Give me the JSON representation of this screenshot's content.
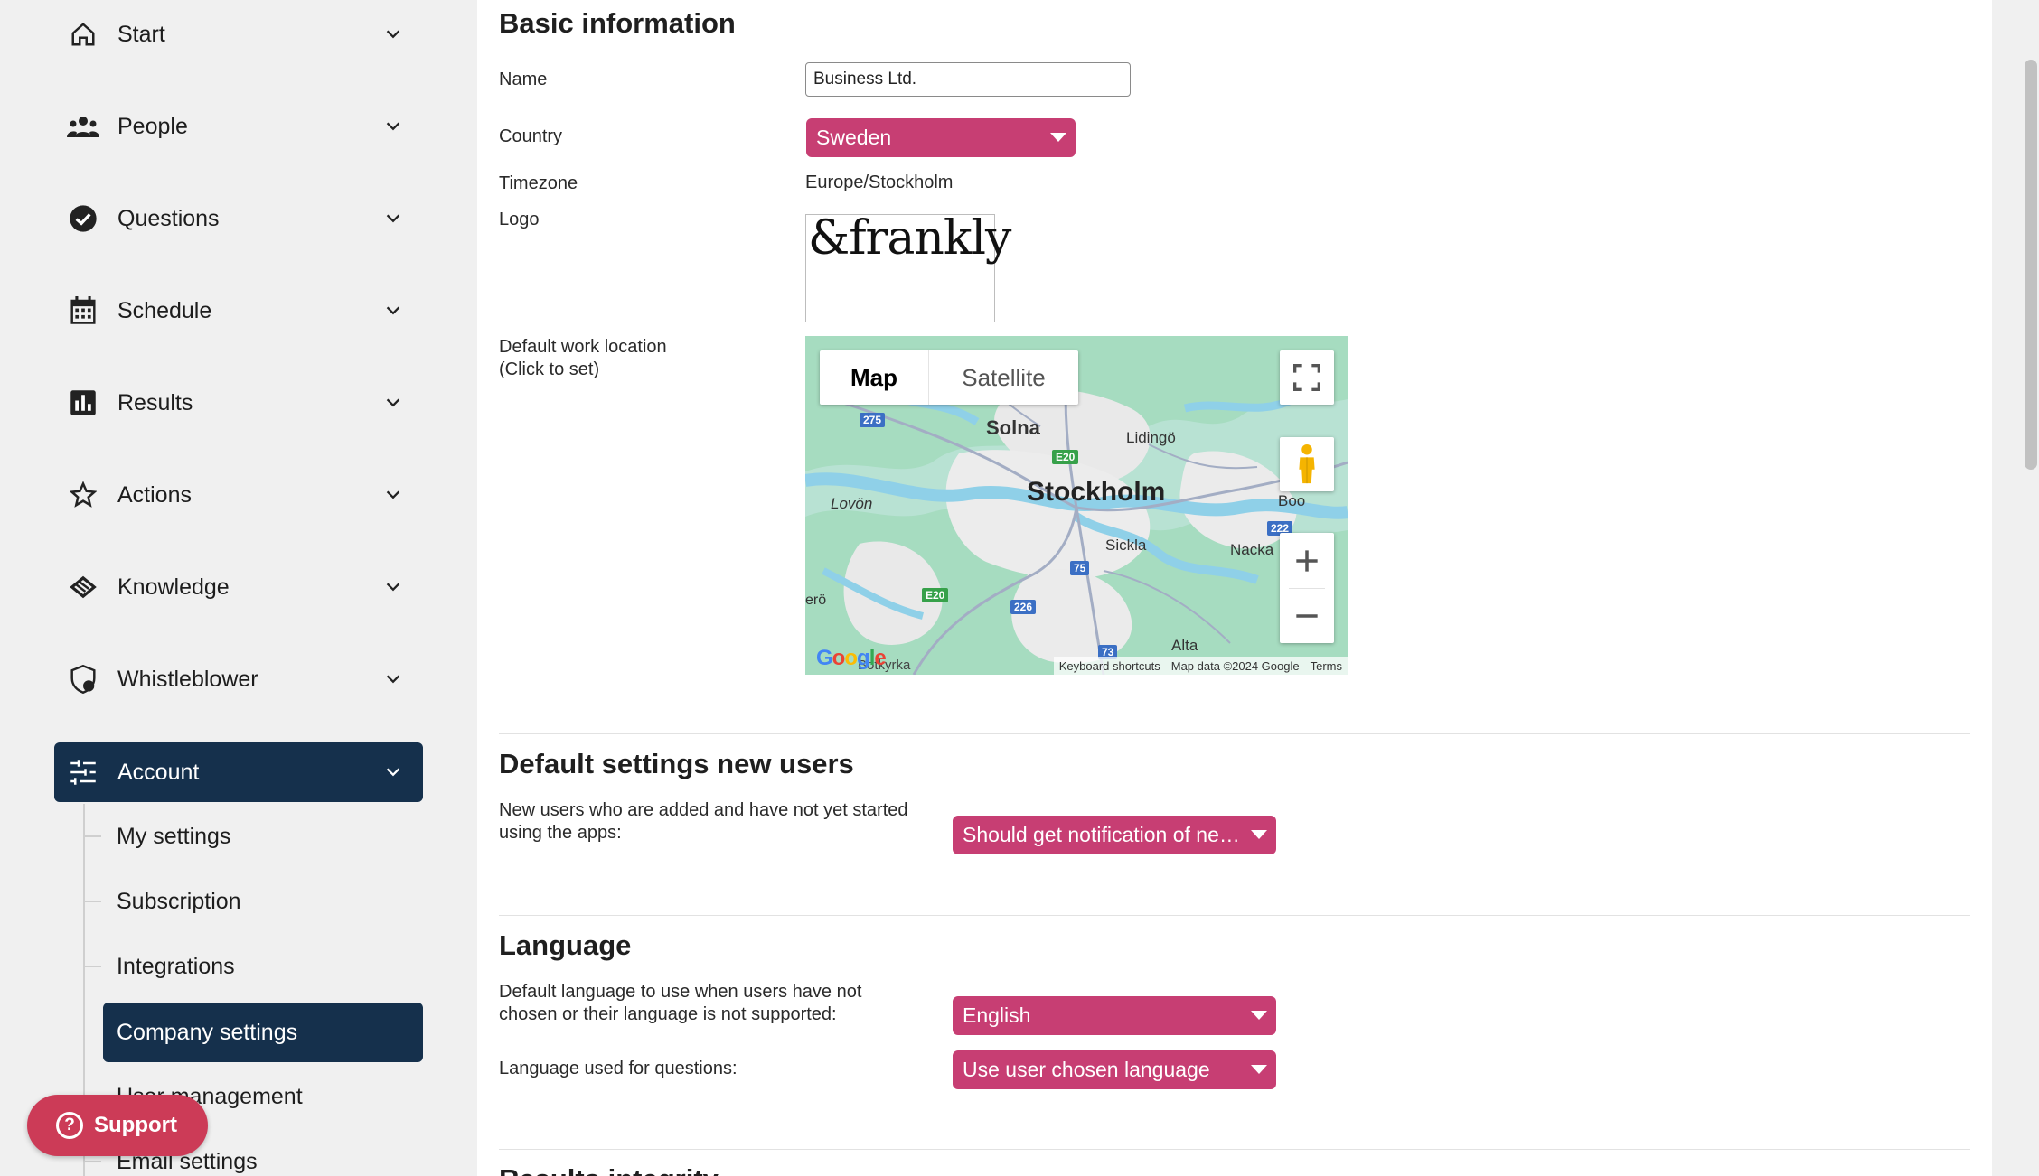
{
  "sidebar": {
    "items": [
      {
        "label": "Start",
        "icon": "home-icon"
      },
      {
        "label": "People",
        "icon": "people-icon"
      },
      {
        "label": "Questions",
        "icon": "check-circle-icon"
      },
      {
        "label": "Schedule",
        "icon": "calendar-icon"
      },
      {
        "label": "Results",
        "icon": "bar-chart-icon"
      },
      {
        "label": "Actions",
        "icon": "star-icon"
      },
      {
        "label": "Knowledge",
        "icon": "knowledge-icon"
      },
      {
        "label": "Whistleblower",
        "icon": "shield-icon"
      },
      {
        "label": "Account",
        "icon": "sliders-icon"
      }
    ],
    "sub_items": [
      {
        "label": "My settings"
      },
      {
        "label": "Subscription"
      },
      {
        "label": "Integrations"
      },
      {
        "label": "Company settings"
      },
      {
        "label": "User management"
      },
      {
        "label": "Email settings"
      }
    ],
    "support_label": "Support"
  },
  "basic": {
    "title": "Basic information",
    "name_label": "Name",
    "name_value": "Business Ltd.",
    "country_label": "Country",
    "country_value": "Sweden",
    "timezone_label": "Timezone",
    "timezone_value": "Europe/Stockholm",
    "logo_label": "Logo",
    "logo_text": "&frankly",
    "location_label": "Default work location",
    "location_hint": "(Click to set)"
  },
  "map": {
    "tab_map": "Map",
    "tab_satellite": "Satellite",
    "places": {
      "stockholm": "Stockholm",
      "solna": "Solna",
      "lidingo": "Lidingö",
      "lovon": "Lovön",
      "boo": "Boo",
      "sickla": "Sickla",
      "nacka": "Nacka",
      "alta": "Alta",
      "botkyrka": "Botkyrka",
      "ekero_fragment": "erö"
    },
    "road_badges": {
      "r275": "275",
      "e20a": "E20",
      "e20b": "E20",
      "r75": "75",
      "r226": "226",
      "r73": "73",
      "r222": "222"
    },
    "footer_shortcuts": "Keyboard shortcuts",
    "footer_data": "Map data ©2024 Google",
    "footer_terms": "Terms",
    "google_logo": "Google",
    "colors": {
      "water": "#b8e2d3",
      "land": "#a8dcc1",
      "urban": "#eeeeee"
    }
  },
  "new_users": {
    "title": "Default settings new users",
    "label": "New users who are added and have not yet started using the apps:",
    "value": "Should get notification of new questions"
  },
  "language": {
    "title": "Language",
    "default_label": "Default language to use when users have not chosen or their language is not supported:",
    "default_value": "English",
    "questions_label": "Language used for questions:",
    "questions_value": "Use user chosen language"
  },
  "next_section_title": "Results integrity",
  "colors": {
    "accent_pink": "#c73e73",
    "navy": "#15304c",
    "support_red": "#cc3b57"
  }
}
